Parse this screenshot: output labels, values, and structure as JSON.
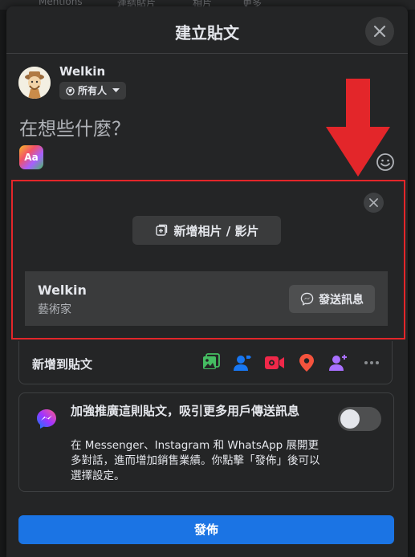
{
  "background_nav": [
    "Mentions",
    "連結貼片",
    "相片",
    "更多"
  ],
  "dialog": {
    "title": "建立貼文",
    "close_icon": "close-icon"
  },
  "author": {
    "name": "Welkin",
    "privacy_label": "所有人",
    "privacy_icon": "globe-icon"
  },
  "composer": {
    "placeholder": "在想些什麼？",
    "text_format_label": "Aa",
    "emoji_icon": "smiley-icon"
  },
  "preview": {
    "add_media_label": "新增相片 / 影片",
    "card_name": "Welkin",
    "card_subtitle": "藝術家",
    "send_message_label": "發送訊息"
  },
  "add_to_post": {
    "label": "新增到貼文",
    "tools": [
      "photo-video-icon",
      "tag-people-icon",
      "live-video-icon",
      "check-in-icon",
      "add-people-icon",
      "more-icon"
    ],
    "colors": {
      "photo": "#45bd62",
      "tag": "#1877f2",
      "live": "#f02849",
      "checkin": "#f5533d",
      "people": "#a970ff"
    }
  },
  "boost": {
    "title": "加強推廣這則貼文，吸引更多用戶傳送訊息",
    "description": "在 Messenger、Instagram 和 WhatsApp 展開更多對話，進而增加銷售業績。你點擊「發佈」後可以選擇設定。",
    "toggle_on": false
  },
  "publish_label": "發佈",
  "accent": "#1b74e4",
  "annotation_color": "#e3262a"
}
